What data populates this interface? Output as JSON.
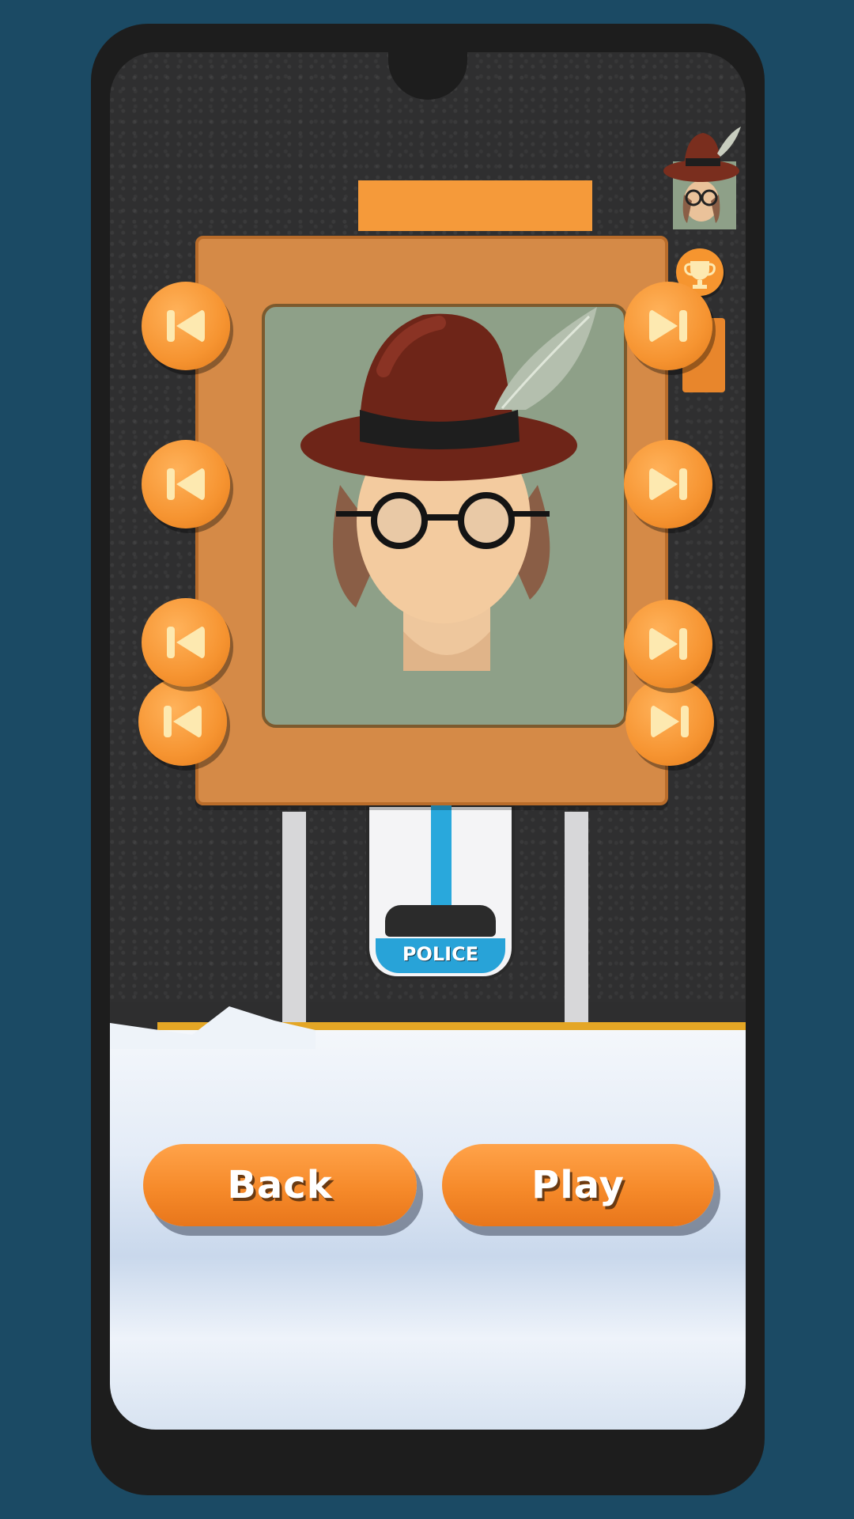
{
  "screen": {
    "title": "",
    "car_label": "POLICE"
  },
  "icons": {
    "prev": "skip-previous-icon",
    "next": "skip-next-icon",
    "trophy": "trophy-icon",
    "gem": "gem-icon"
  },
  "buttons": {
    "back_label": "Back",
    "play_label": "Play"
  },
  "colors": {
    "accent": "#f69431",
    "frame": "#d58a47",
    "portrait_bg": "#8ea088",
    "background": "#1b4a64"
  }
}
